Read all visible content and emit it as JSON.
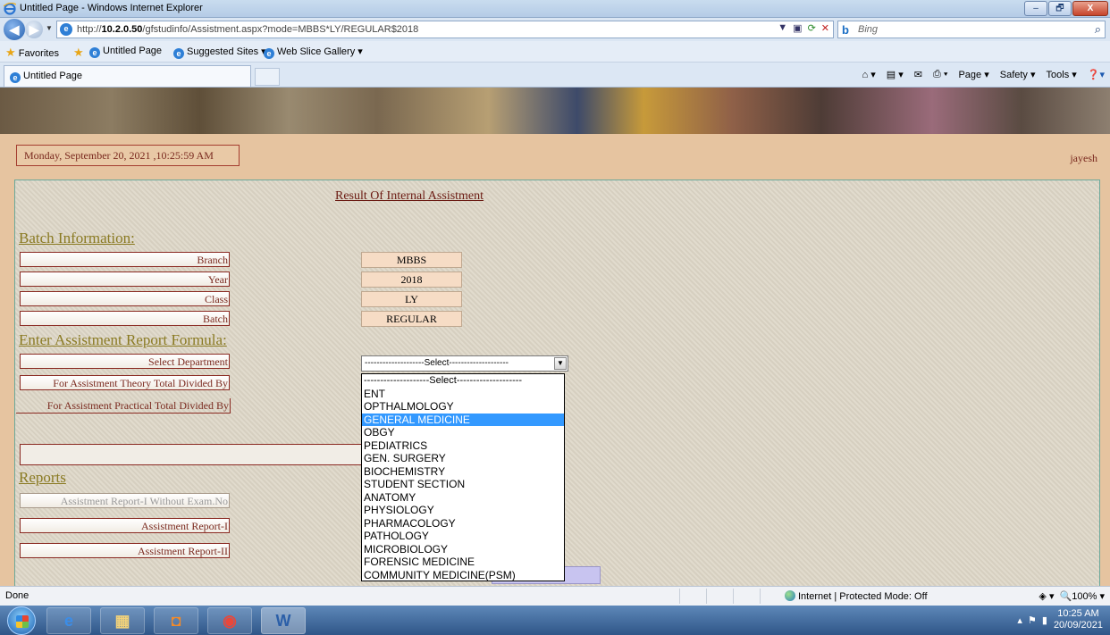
{
  "window": {
    "title": "Untitled Page - Windows Internet Explorer",
    "buttons": [
      "–",
      "🗗",
      "X"
    ]
  },
  "address": {
    "url_prefix": "http://",
    "url_host": "10.2.0.50",
    "url_path": "/gfstudinfo/Assistment.aspx?mode=MBBS*LY/REGULAR$2018",
    "search_placeholder": "Bing"
  },
  "favorites": {
    "label": "Favorites",
    "items": [
      "Untitled Page",
      "Suggested Sites ▾",
      "Web Slice Gallery ▾"
    ]
  },
  "tabs": {
    "active": "Untitled Page"
  },
  "commandbar": {
    "items": [
      "Page ▾",
      "Safety ▾",
      "Tools ▾"
    ]
  },
  "page": {
    "datetime": "Monday, September 20, 2021 ,10:25:59 AM",
    "user": "jayesh",
    "title": "Result Of Internal Assistment",
    "batch_heading": "Batch Information:",
    "batch_rows": [
      {
        "label": "Branch",
        "value": "MBBS"
      },
      {
        "label": "Year",
        "value": "2018"
      },
      {
        "label": "Class",
        "value": "LY"
      },
      {
        "label": "Batch",
        "value": "REGULAR"
      }
    ],
    "formula_heading": "Enter Assistment Report Formula:",
    "select_dept_label": "Select Department",
    "theory_label": "For Assistment Theory Total Divided By",
    "practical_label": "For Assistment Practical Total Divided By",
    "dept_select_value": "--------------------Select--------------------",
    "dept_options": [
      "--------------------Select--------------------",
      "ENT",
      "OPTHALMOLOGY",
      "GENERAL MEDICINE",
      "OBGY",
      "PEDIATRICS",
      "GEN. SURGERY",
      "BIOCHEMISTRY",
      "STUDENT SECTION",
      "ANATOMY",
      "PHYSIOLOGY",
      "PHARMACOLOGY",
      "PATHOLOGY",
      "MICROBIOLOGY",
      "FORENSIC MEDICINE",
      "COMMUNITY MEDICINE(PSM)"
    ],
    "highlighted_option": "GENERAL MEDICINE",
    "reports_heading": "Reports",
    "reports": [
      "Assistment Report-I Without Exam.No",
      "Assistment Report-I",
      "Assistment Report-II"
    ]
  },
  "statusbar": {
    "status": "Done",
    "zone": "Internet | Protected Mode: Off",
    "zoom": "100%"
  },
  "taskbar": {
    "time": "10:25 AM",
    "date": "20/09/2021"
  },
  "colors": {
    "page_bg": "#e6c4a0",
    "label_text": "#7a2a1f",
    "heading": "#8a7a22",
    "selection": "#3399ff"
  }
}
